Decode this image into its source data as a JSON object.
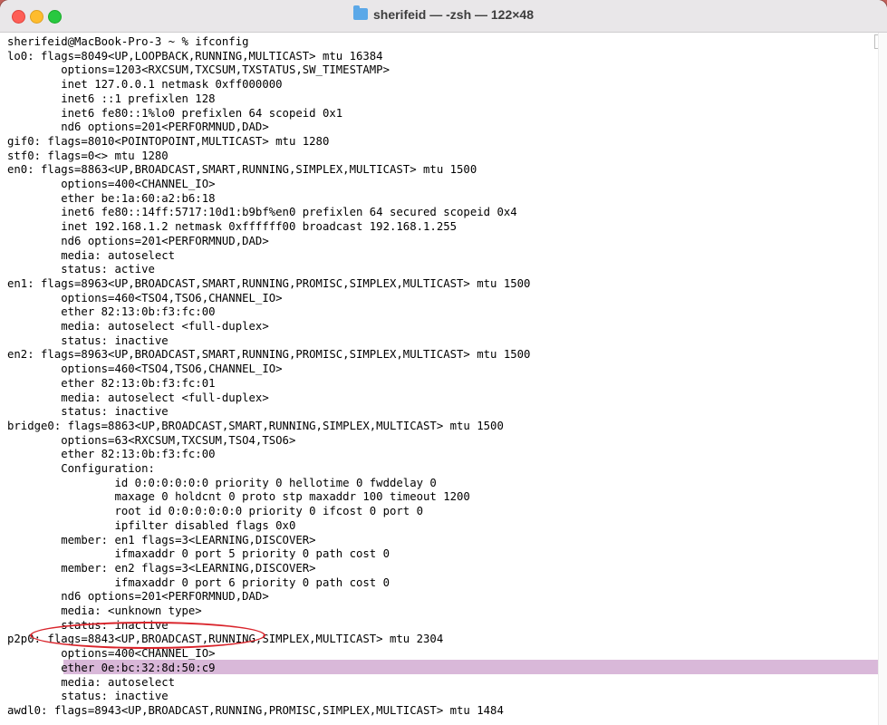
{
  "window": {
    "title": "sherifeid — -zsh — 122×48",
    "folder_icon": "folder-icon"
  },
  "terminal": {
    "highlight_color": "#d9b8d9",
    "annotation_color": "#d9242b",
    "lines": [
      "sherifeid@MacBook-Pro-3 ~ % ifconfig",
      "lo0: flags=8049<UP,LOOPBACK,RUNNING,MULTICAST> mtu 16384",
      "        options=1203<RXCSUM,TXCSUM,TXSTATUS,SW_TIMESTAMP>",
      "        inet 127.0.0.1 netmask 0xff000000",
      "        inet6 ::1 prefixlen 128",
      "        inet6 fe80::1%lo0 prefixlen 64 scopeid 0x1",
      "        nd6 options=201<PERFORMNUD,DAD>",
      "gif0: flags=8010<POINTOPOINT,MULTICAST> mtu 1280",
      "stf0: flags=0<> mtu 1280",
      "en0: flags=8863<UP,BROADCAST,SMART,RUNNING,SIMPLEX,MULTICAST> mtu 1500",
      "        options=400<CHANNEL_IO>",
      "        ether be:1a:60:a2:b6:18",
      "        inet6 fe80::14ff:5717:10d1:b9bf%en0 prefixlen 64 secured scopeid 0x4",
      "        inet 192.168.1.2 netmask 0xffffff00 broadcast 192.168.1.255",
      "        nd6 options=201<PERFORMNUD,DAD>",
      "        media: autoselect",
      "        status: active",
      "en1: flags=8963<UP,BROADCAST,SMART,RUNNING,PROMISC,SIMPLEX,MULTICAST> mtu 1500",
      "        options=460<TSO4,TSO6,CHANNEL_IO>",
      "        ether 82:13:0b:f3:fc:00",
      "        media: autoselect <full-duplex>",
      "        status: inactive",
      "en2: flags=8963<UP,BROADCAST,SMART,RUNNING,PROMISC,SIMPLEX,MULTICAST> mtu 1500",
      "        options=460<TSO4,TSO6,CHANNEL_IO>",
      "        ether 82:13:0b:f3:fc:01",
      "        media: autoselect <full-duplex>",
      "        status: inactive",
      "bridge0: flags=8863<UP,BROADCAST,SMART,RUNNING,SIMPLEX,MULTICAST> mtu 1500",
      "        options=63<RXCSUM,TXCSUM,TSO4,TSO6>",
      "        ether 82:13:0b:f3:fc:00",
      "        Configuration:",
      "                id 0:0:0:0:0:0 priority 0 hellotime 0 fwddelay 0",
      "                maxage 0 holdcnt 0 proto stp maxaddr 100 timeout 1200",
      "                root id 0:0:0:0:0:0 priority 0 ifcost 0 port 0",
      "                ipfilter disabled flags 0x0",
      "        member: en1 flags=3<LEARNING,DISCOVER>",
      "                ifmaxaddr 0 port 5 priority 0 path cost 0",
      "        member: en2 flags=3<LEARNING,DISCOVER>",
      "                ifmaxaddr 0 port 6 priority 0 path cost 0",
      "        nd6 options=201<PERFORMNUD,DAD>",
      "        media: <unknown type>",
      "        status: inactive",
      "p2p0: flags=8843<UP,BROADCAST,RUNNING,SIMPLEX,MULTICAST> mtu 2304",
      "        options=400<CHANNEL_IO>",
      "        ether 0e:bc:32:8d:50:c9",
      "        media: autoselect",
      "        status: inactive",
      "awdl0: flags=8943<UP,BROADCAST,RUNNING,PROMISC,SIMPLEX,MULTICAST> mtu 1484"
    ]
  }
}
